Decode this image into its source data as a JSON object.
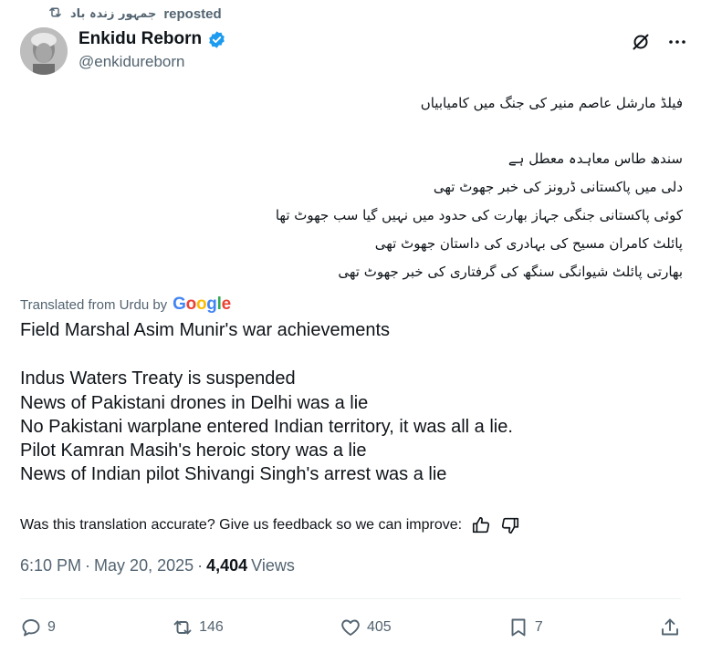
{
  "repost": {
    "user": "جمہور زندہ باد",
    "label": "reposted",
    "icon": "repost-icon"
  },
  "author": {
    "name": "Enkidu Reborn",
    "handle": "@enkidureborn",
    "verified": true,
    "avatar": "avatar",
    "verified_color": "#1d9bf0"
  },
  "header_icons": [
    "grok-icon",
    "more-icon"
  ],
  "tweet": {
    "urdu_lines": [
      "فیلڈ مارشل عاصم منیر کی جنگ میں کامیابیاں",
      "",
      "سندھ طاس معاہدہ معطل ہے",
      "دلی میں پاکستانی ڈرونز کی خبر جھوٹ تھی",
      "کوئی پاکستانی جنگی جہاز بھارت کی حدود میں نہیں گیا سب جھوٹ تھا",
      "پائلٹ کامران مسیح کی بہادری کی داستان جھوٹ تھی",
      "بھارتی پائلٹ شیوانگی سنگھ کی گرفتاری کی خبر جھوٹ تھی"
    ],
    "translated_label": "Translated from Urdu by",
    "translator_logo": [
      "G",
      "o",
      "o",
      "g",
      "l",
      "e"
    ],
    "english_lines": [
      "Field Marshal Asim Munir's war achievements",
      "",
      "Indus Waters Treaty is suspended",
      "News of Pakistani drones in Delhi was a lie",
      "No Pakistani warplane entered Indian territory, it was all a lie.",
      "Pilot Kamran Masih's heroic story was a lie",
      "News of Indian pilot Shivangi Singh's arrest was a lie"
    ],
    "feedback_text": "Was this translation accurate? Give us feedback so we can improve:"
  },
  "meta": {
    "time": "6:10 PM",
    "date": "May 20, 2025",
    "views_count": "4,404",
    "views_label": "Views"
  },
  "actions": {
    "replies": "9",
    "reposts": "146",
    "likes": "405",
    "bookmarks": "7"
  },
  "colors": {
    "text": "#0f1419",
    "secondary": "#536471",
    "divider": "#eff3f4"
  }
}
